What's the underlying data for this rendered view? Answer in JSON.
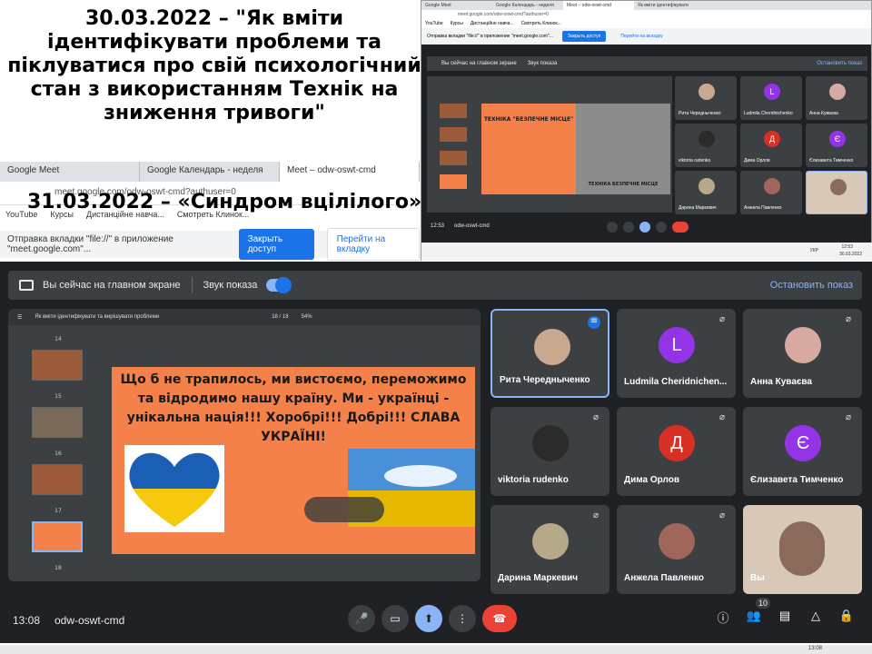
{
  "caption": {
    "line1": "30.03.2022 – \"Як вміти ідентифікувати проблеми та піклуватися про свій психологічний стан з використанням Технік на зниження тривоги\"",
    "line2": "31.03.2022 –  «Синдром вцілілого»"
  },
  "background_browser": {
    "tabs": [
      "Google Meet",
      "Google Календарь - неделя",
      "Meet – odw-oswt-cmd"
    ],
    "url": "meet.google.com/odw-oswt-cmd?authuser=0",
    "bookmarks": [
      "YouTube",
      "Курсы",
      "Дистанційне навча...",
      "Смотреть Клинок..."
    ],
    "share_bar": {
      "message": "Отправка вкладки \"file://\" в приложение \"meet.google.com\"...",
      "allow_button": "Закрыть доступ",
      "switch_button": "Перейти на вкладку"
    }
  },
  "meet": {
    "presenting_bar": {
      "label": "Вы сейчас на главном экране",
      "audio_label": "Звук показа",
      "audio_on": true,
      "stop_button": "Остановить показ"
    },
    "presentation": {
      "doc_title": "Як вміти ідентифікувати та вирішувати проблеми",
      "page": "18 / 18",
      "zoom": "54%",
      "thumb_labels": [
        "14",
        "15",
        "16",
        "17",
        "18"
      ],
      "slide_text": "Що б не трапилось, ми вистоємо, переможимо та відродимо нашу країну. Ми - українці - унікальна нація!!! Хоробрі!!! Добрі!!! СЛАВА УКРАЇНІ!"
    },
    "participants": [
      {
        "name": "Рита Чередныченко",
        "initial": "",
        "color": "#c9a890",
        "speaking": true
      },
      {
        "name": "Ludmila Cheridnichen...",
        "initial": "L",
        "color": "#9334e6",
        "speaking": false
      },
      {
        "name": "Анна Куваєва",
        "initial": "",
        "color": "#d7a9a0",
        "speaking": false
      },
      {
        "name": "viktoria rudenko",
        "initial": "",
        "color": "#2b2b2b",
        "speaking": false
      },
      {
        "name": "Дима Орлов",
        "initial": "Д",
        "color": "#d93025",
        "speaking": false
      },
      {
        "name": "Єлизавета Тимченко",
        "initial": "Є",
        "color": "#9334e6",
        "speaking": false
      },
      {
        "name": "Дарина Маркевич",
        "initial": "",
        "color": "#b5a98a",
        "speaking": false
      },
      {
        "name": "Анжела Павленко",
        "initial": "",
        "color": "#a0665a",
        "speaking": false
      },
      {
        "name": "Вы",
        "initial": "",
        "color": "#d8c8b8",
        "speaking": false
      }
    ],
    "controls": {
      "time": "13:08",
      "meeting_code": "odw-oswt-cmd",
      "people_count": "10"
    }
  },
  "inset": {
    "tabs": [
      "Google Meet",
      "Google Календарь - неделя",
      "Meet – odw-oswt-cmd",
      "Як вміти ідентифікувати"
    ],
    "url": "meet.google.com/odw-oswt-cmd?authuser=0",
    "bookmarks": [
      "YouTube",
      "Курсы",
      "Дистанційне навча...",
      "Смотреть Клинок..."
    ],
    "share_message": "Отправка вкладки \"file://\" в приложение \"meet.google.com\"...",
    "allow_button": "Закрыть доступ",
    "switch_button": "Перейти на вкладку",
    "presenting_label": "Вы сейчас на главном экране",
    "audio_label": "Звук показа",
    "stop_button": "Остановить показ",
    "slide_title": "ТЕХНІКА \"БЕЗПЕЧНЕ МІСЦЕ\"",
    "photo_caption": "ТЕХНІКА БЕЗПЕЧНЕ МІСЦЕ",
    "participants": [
      {
        "name": "Рита Чередныченко",
        "initial": "",
        "color": "#c9a890"
      },
      {
        "name": "Ludmila Cheridnichenko",
        "initial": "L",
        "color": "#9334e6"
      },
      {
        "name": "Анна Куваєва",
        "initial": "",
        "color": "#d7a9a0"
      },
      {
        "name": "viktoria rudenko",
        "initial": "",
        "color": "#2b2b2b"
      },
      {
        "name": "Дима Орлов",
        "initial": "Д",
        "color": "#d93025"
      },
      {
        "name": "Єлизавета Тимченко",
        "initial": "Є",
        "color": "#9334e6"
      },
      {
        "name": "Дарина Маркевич",
        "initial": "",
        "color": "#b5a98a"
      },
      {
        "name": "Анжела Павленко",
        "initial": "",
        "color": "#a0665a"
      },
      {
        "name": "",
        "initial": "",
        "color": "#d8c8b8"
      }
    ],
    "time": "12:53",
    "meeting_code": "odw-oswt-cmd",
    "clock": "12:53",
    "date": "30.03.2022",
    "lang": "УКР"
  },
  "taskbar": {
    "time": "13:08"
  }
}
